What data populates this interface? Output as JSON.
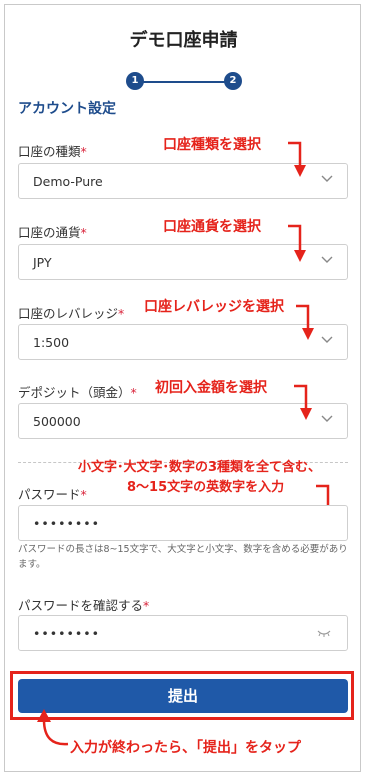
{
  "title": "デモ口座申請",
  "stepper": {
    "step1": "1",
    "step2": "2"
  },
  "section_title": "アカウント設定",
  "account_type": {
    "label": "口座の種類",
    "required": "*",
    "value": "Demo-Pure",
    "annotation": "口座種類を選択"
  },
  "currency": {
    "label": "口座の通貨",
    "required": "*",
    "value": "JPY",
    "annotation": "口座通貨を選択"
  },
  "leverage": {
    "label": "口座のレバレッジ",
    "required": "*",
    "value": "1:500",
    "annotation": "口座レバレッジを選択"
  },
  "deposit": {
    "label": "デポジット（頭金）",
    "required": "*",
    "value": "500000",
    "annotation": "初回入金額を選択"
  },
  "password": {
    "label": "パスワード",
    "required": "*",
    "value": "••••••••",
    "annotation_line1": "小文字･大文字･数字の3種類を全て含む、",
    "annotation_line2": "8〜15文字の英数字を入力",
    "hint": "パスワードの長さは8~15文字で、大文字と小文字、数字を含める必要があります。"
  },
  "confirm_password": {
    "label": "パスワードを確認する",
    "required": "*",
    "value": "••••••••"
  },
  "submit": {
    "label": "提出",
    "annotation": "入力が終わったら、「提出」をタップ"
  },
  "colors": {
    "brand_blue": "#1e4c8c",
    "button_blue": "#1f59a8",
    "annotation_red": "#e5231b"
  }
}
